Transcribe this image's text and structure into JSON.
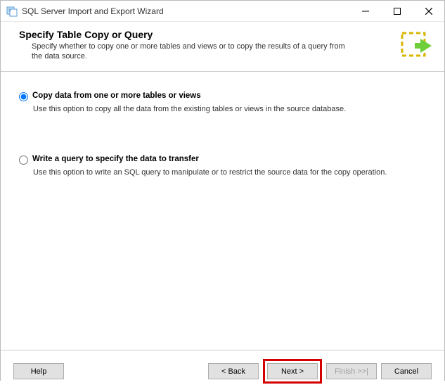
{
  "window": {
    "title": "SQL Server Import and Export Wizard"
  },
  "header": {
    "title": "Specify Table Copy or Query",
    "description": "Specify whether to copy one or more tables and views or to copy the results of a query from the data source."
  },
  "options": {
    "copy": {
      "label": "Copy data from one or more tables or views",
      "description": "Use this option to copy all the data from the existing tables or views in the source database.",
      "selected": true
    },
    "query": {
      "label": "Write a query to specify the data to transfer",
      "description": "Use this option to write an SQL query to manipulate or to restrict the source data for the copy operation.",
      "selected": false
    }
  },
  "buttons": {
    "help": "Help",
    "back": "< Back",
    "next": "Next >",
    "finish": "Finish >>|",
    "cancel": "Cancel"
  }
}
